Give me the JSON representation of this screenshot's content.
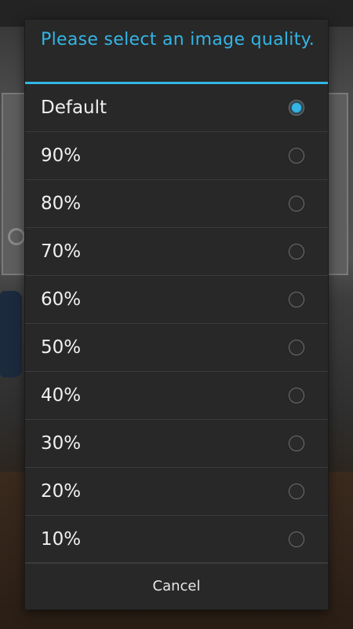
{
  "dialog": {
    "title": "Please select an image quality.",
    "accent_color": "#33b5e5",
    "options": [
      {
        "label": "Default",
        "selected": true
      },
      {
        "label": "90%",
        "selected": false
      },
      {
        "label": "80%",
        "selected": false
      },
      {
        "label": "70%",
        "selected": false
      },
      {
        "label": "60%",
        "selected": false
      },
      {
        "label": "50%",
        "selected": false
      },
      {
        "label": "40%",
        "selected": false
      },
      {
        "label": "30%",
        "selected": false
      },
      {
        "label": "20%",
        "selected": false
      },
      {
        "label": "10%",
        "selected": false
      }
    ],
    "cancel_label": "Cancel"
  }
}
